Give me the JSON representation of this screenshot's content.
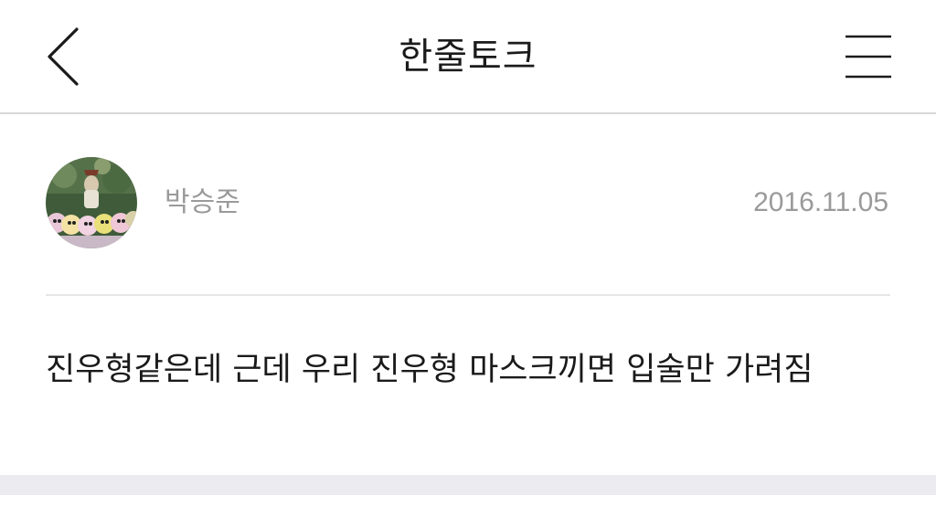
{
  "header": {
    "title": "한줄토크",
    "back_icon": "chevron-left-icon",
    "menu_icon": "hamburger-menu-icon"
  },
  "post": {
    "author": "박승준",
    "date": "2016.11.05",
    "comment": "진우형같은데 근데 우리 진우형 마스크끼면 입술만 가려짐"
  },
  "colors": {
    "divider": "#d9d9d9",
    "meta_text": "#9a9a9a",
    "body_text": "#1a1a1a",
    "bottom_band": "#ececf0"
  }
}
